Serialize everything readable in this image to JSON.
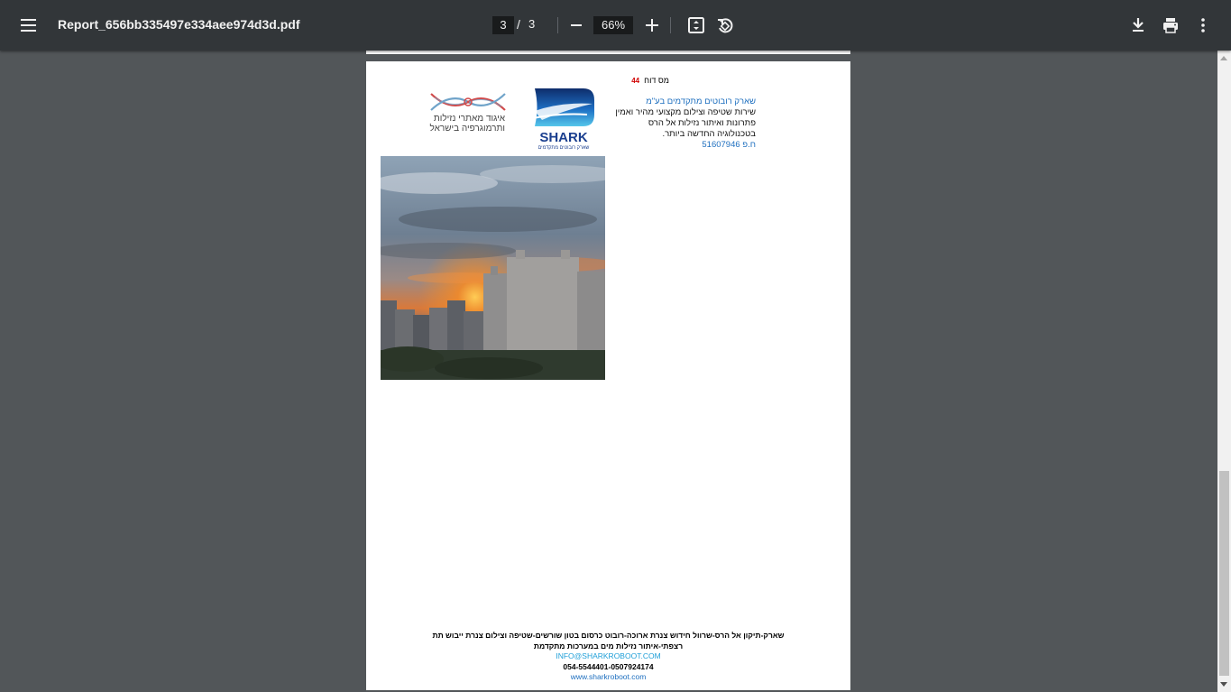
{
  "toolbar": {
    "file_name": "Report_656bb335497e334aee974d3d.pdf",
    "current_page": "3",
    "page_separator": "/",
    "total_pages": "3",
    "zoom": "66%",
    "icons": [
      "menu-icon",
      "zoom-out-icon",
      "zoom-in-icon",
      "fit-page-icon",
      "rotate-icon",
      "download-icon",
      "print-icon",
      "more-vert-icon"
    ]
  },
  "document": {
    "report_label": "מס דוח",
    "report_number": "44",
    "company": {
      "name": "שארק רובוטים מתקדמים בע\"מ",
      "line1": "שירות שטיפה וצילום מקצועי מהיר ואמין",
      "line2": "פתרונות ואיתור נזילות אל הרס",
      "line3": "בטכנולוגיה החדשה ביותר.",
      "id": "ח.פ 51607946"
    },
    "shark_logo": {
      "wordmark": "SHARK",
      "tagline": "שארק רובוטים מתקדמים"
    },
    "union_logo": {
      "line1": "איגוד מאתרי נזילות",
      "line2": "ותרמוגרפיה בישראל"
    },
    "photo_alt": "sunset-over-buildings",
    "footer": {
      "line1": "שארק-תיקון אל הרס-שרוול חידוש צנרת ארוכה-רובוט כרסום בטון שורשים-שטיפה וצילום צנרת ייבוש תת",
      "line2": "רצפתי-איתור נזילות מים במערכות מתקדמת",
      "email": "INFO@SHARKROBOOT.COM",
      "phones": "054-5544401-0507924174",
      "website": "www.sharkroboot.com"
    }
  },
  "colors": {
    "toolbar_bg": "#323639",
    "viewer_bg": "#525659",
    "accent_blue": "#1e6fbf",
    "report_number_red": "#d00000"
  }
}
